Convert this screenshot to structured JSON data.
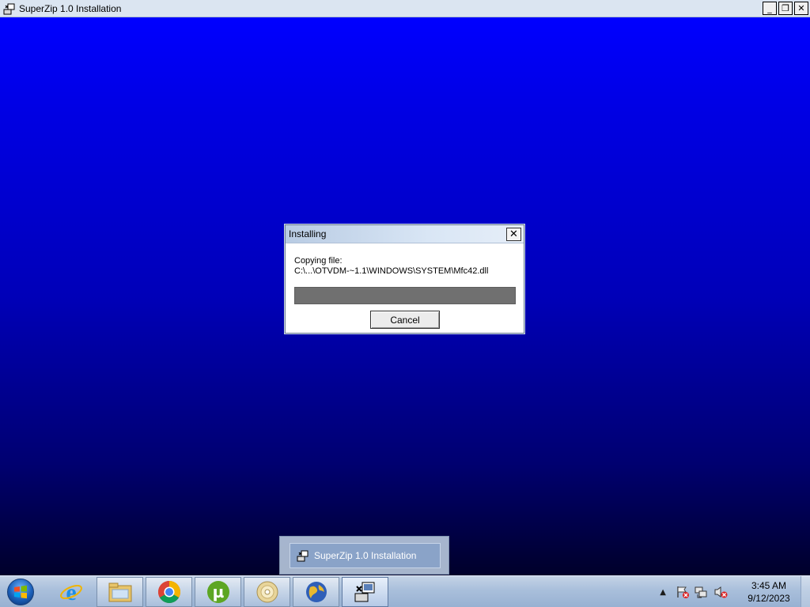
{
  "window": {
    "title": "SuperZip 1.0 Installation",
    "controls": {
      "minimize": "_",
      "restore": "❐",
      "close": "✕"
    }
  },
  "dialog": {
    "title": "Installing",
    "close": "✕",
    "status_line1": "Copying file:",
    "status_line2": "C:\\...\\OTVDM-~1.1\\WINDOWS\\SYSTEM\\Mfc42.dll",
    "progress_fraction": 0.0,
    "cancel_label": "Cancel"
  },
  "thumbnail_popup": {
    "label": "SuperZip 1.0 Installation"
  },
  "taskbar": {
    "buttons": [
      {
        "name": "internet-explorer",
        "icon": "ie-icon"
      },
      {
        "name": "file-explorer",
        "icon": "folder-icon"
      },
      {
        "name": "chrome",
        "icon": "chrome-icon"
      },
      {
        "name": "utorrent",
        "icon": "utorrent-icon"
      },
      {
        "name": "media-player",
        "icon": "disc-icon"
      },
      {
        "name": "globe-app",
        "icon": "globe-icon"
      },
      {
        "name": "superzip-installer",
        "icon": "installer-icon",
        "active": true
      }
    ],
    "tray": {
      "expand": "▲",
      "time": "3:45 AM",
      "date": "9/12/2023"
    }
  },
  "colors": {
    "desktop_top": "#0000ff",
    "desktop_bottom": "#00002a",
    "progress_track": "#707070"
  }
}
